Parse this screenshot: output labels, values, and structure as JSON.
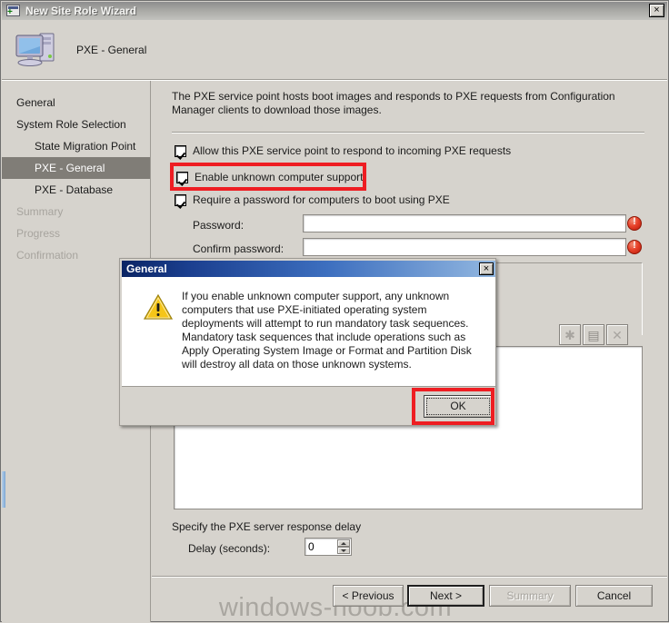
{
  "window": {
    "title": "New Site Role Wizard",
    "icon": "wizard-icon",
    "close_label": "×"
  },
  "header": {
    "title": "PXE - General",
    "icon": "computer-icon"
  },
  "sidebar": {
    "items": [
      {
        "label": "General",
        "indent": false,
        "selected": false,
        "disabled": false
      },
      {
        "label": "System Role Selection",
        "indent": false,
        "selected": false,
        "disabled": false
      },
      {
        "label": "State Migration Point",
        "indent": true,
        "selected": false,
        "disabled": false
      },
      {
        "label": "PXE - General",
        "indent": true,
        "selected": true,
        "disabled": false
      },
      {
        "label": "PXE - Database",
        "indent": true,
        "selected": false,
        "disabled": false
      },
      {
        "label": "Summary",
        "indent": false,
        "selected": false,
        "disabled": true
      },
      {
        "label": "Progress",
        "indent": false,
        "selected": false,
        "disabled": true
      },
      {
        "label": "Confirmation",
        "indent": false,
        "selected": false,
        "disabled": true
      }
    ]
  },
  "main": {
    "description": "The PXE service point hosts boot images and responds to PXE requests from Configuration Manager clients to download those images.",
    "checkboxes": [
      {
        "label": "Allow this PXE service point to respond to incoming PXE requests",
        "checked": true
      },
      {
        "label": "Enable unknown computer support",
        "checked": true,
        "highlighted": true
      },
      {
        "label": "Require a password for computers to boot using PXE",
        "checked": true
      }
    ],
    "password": {
      "label": "Password:",
      "value": "",
      "placeholder": "",
      "error_icon": "error-icon"
    },
    "confirm_password": {
      "label": "Confirm password:",
      "value": "",
      "placeholder": "",
      "error_icon": "error-icon"
    },
    "toolbar_buttons": [
      {
        "icon": "new-item-icon",
        "glyph": "✱",
        "enabled": false
      },
      {
        "icon": "properties-icon",
        "glyph": "▤",
        "enabled": false
      },
      {
        "icon": "delete-icon",
        "glyph": "✕",
        "enabled": false
      }
    ],
    "delay": {
      "section_title": "Specify the PXE server response delay",
      "label": "Delay (seconds):",
      "value": "0"
    }
  },
  "footer": {
    "buttons": [
      {
        "label": "< Previous",
        "default": false,
        "disabled": false
      },
      {
        "label": "Next >",
        "default": true,
        "disabled": false
      },
      {
        "label": "Summary",
        "default": false,
        "disabled": true
      },
      {
        "label": "Cancel",
        "default": false,
        "disabled": false
      }
    ]
  },
  "watermark": "windows-noob.com",
  "dialog": {
    "title": "General",
    "close_label": "×",
    "icon": "warning-icon",
    "message": "If you enable unknown computer support, any unknown computers that use PXE-initiated operating system deployments will attempt to run mandatory task sequences. Mandatory task sequences that include operations such as Apply Operating System Image or Format and Partition Disk will destroy all data on those unknown systems.",
    "ok_label": "OK"
  },
  "colors": {
    "annotation": "#ee1d22",
    "selected_nav": "#807d77",
    "dialog_title_start": "#0a2464",
    "dialog_title_end": "#92b7e0",
    "error": "#e8422a",
    "warning": "#f5c518",
    "face": "#d6d3cd"
  }
}
